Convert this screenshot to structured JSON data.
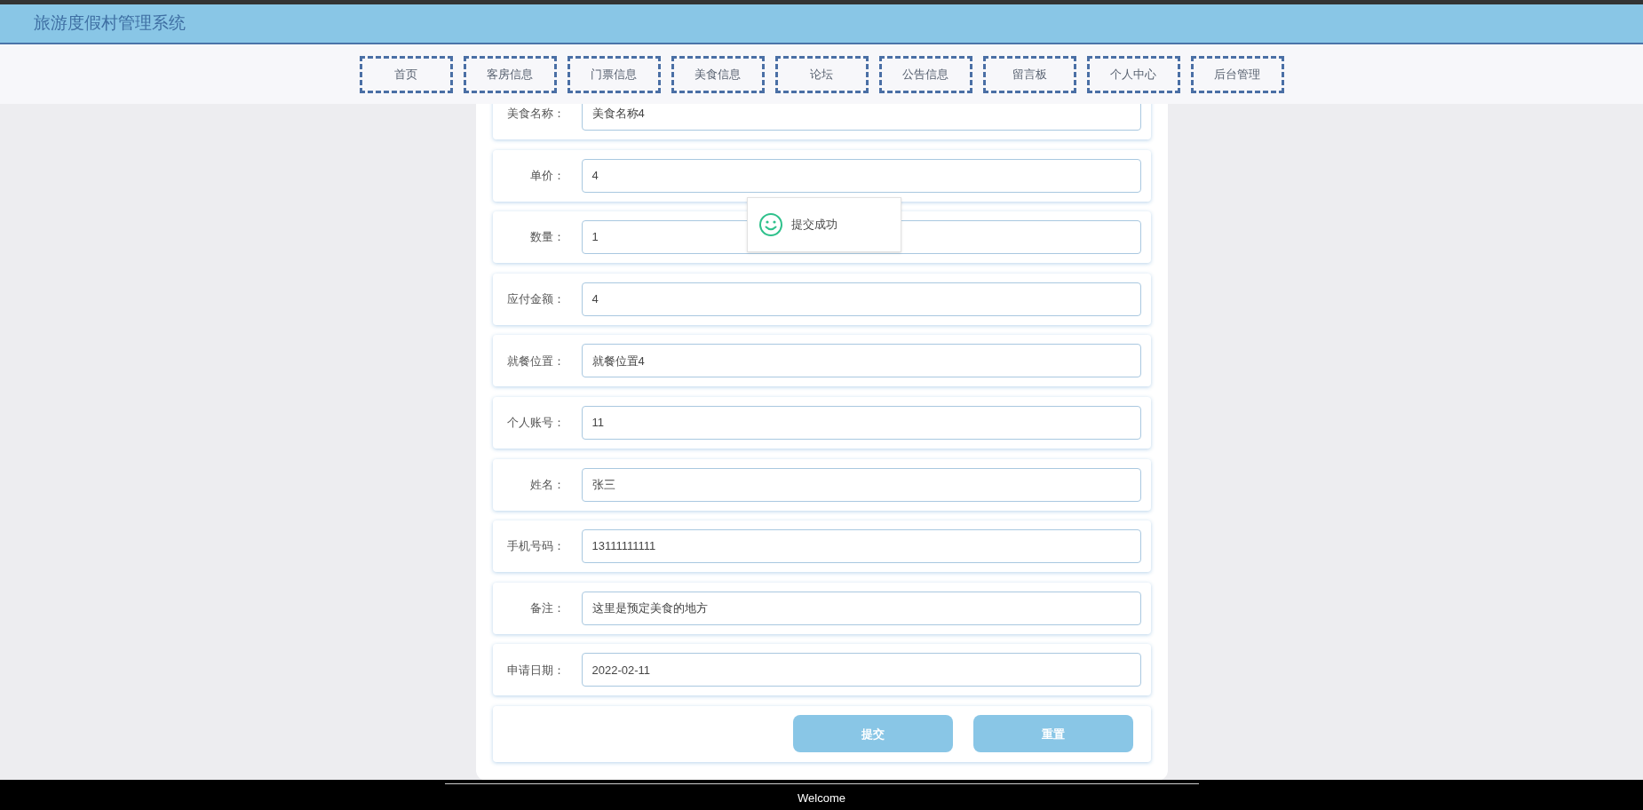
{
  "header": {
    "title": "旅游度假村管理系统"
  },
  "nav": [
    {
      "label": "首页"
    },
    {
      "label": "客房信息"
    },
    {
      "label": "门票信息"
    },
    {
      "label": "美食信息"
    },
    {
      "label": "论坛"
    },
    {
      "label": "公告信息"
    },
    {
      "label": "留言板"
    },
    {
      "label": "个人中心"
    },
    {
      "label": "后台管理"
    }
  ],
  "form": {
    "fields": [
      {
        "label": "美食名称：",
        "value": "美食名称4"
      },
      {
        "label": "单价：",
        "value": "4"
      },
      {
        "label": "数量：",
        "value": "1"
      },
      {
        "label": "应付金额：",
        "value": "4"
      },
      {
        "label": "就餐位置：",
        "value": "就餐位置4"
      },
      {
        "label": "个人账号：",
        "value": "11"
      },
      {
        "label": "姓名：",
        "value": "张三"
      },
      {
        "label": "手机号码：",
        "value": "13111111111"
      },
      {
        "label": "备注：",
        "value": "这里是预定美食的地方"
      },
      {
        "label": "申请日期：",
        "value": "2022-02-11"
      }
    ],
    "buttons": [
      {
        "label": "提交"
      },
      {
        "label": "重置"
      }
    ]
  },
  "toast": {
    "message": "提交成功"
  },
  "footer": {
    "text": "Welcome"
  }
}
